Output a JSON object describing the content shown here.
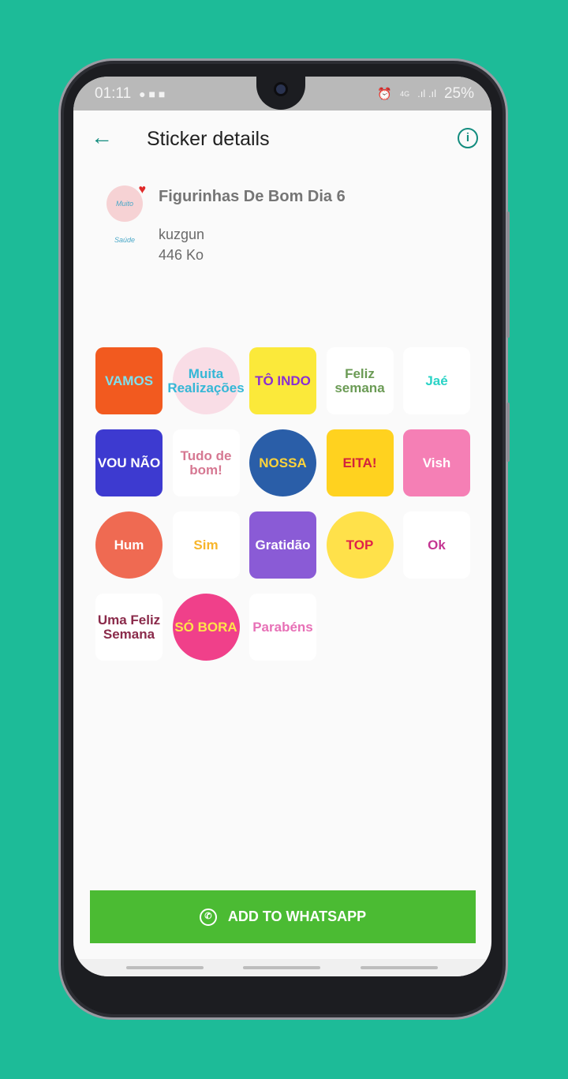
{
  "status_bar": {
    "time": "01:11",
    "battery": "25%",
    "network": "4G"
  },
  "toolbar": {
    "title": "Sticker details",
    "back_icon": "arrow-left-icon",
    "info_icon": "info-icon"
  },
  "pack": {
    "tray_text": "Muito Saúde",
    "name": "Figurinhas De Bom Dia 6",
    "publisher": "kuzgun",
    "size": "446 Ko"
  },
  "stickers": [
    {
      "text": "VAMOS",
      "bg": "#f25a1f",
      "fg": "#7fe0ee"
    },
    {
      "text": "Muita Realizações",
      "bg": "#f9dde6",
      "fg": "#35b7d6"
    },
    {
      "text": "TÔ INDO",
      "bg": "#fbe93a",
      "fg": "#8a2fd1"
    },
    {
      "text": "Feliz semana",
      "bg": "#ffffff",
      "fg": "#6b9b55"
    },
    {
      "text": "Jaé",
      "bg": "#ffffff",
      "fg": "#2ad3c6"
    },
    {
      "text": "VOU NÃO",
      "bg": "#3d3ad0",
      "fg": "#ffffff"
    },
    {
      "text": "Tudo de bom!",
      "bg": "#ffffff",
      "fg": "#d67892"
    },
    {
      "text": "NOSSA",
      "bg": "#2a5ea8",
      "fg": "#ffd43a"
    },
    {
      "text": "EITA!",
      "bg": "#ffd21f",
      "fg": "#d1233d"
    },
    {
      "text": "Vish",
      "bg": "#f57fb5",
      "fg": "#ffffff"
    },
    {
      "text": "Hum",
      "bg": "#ef6a52",
      "fg": "#ffffff"
    },
    {
      "text": "Sim",
      "bg": "#ffffff",
      "fg": "#f7b52a"
    },
    {
      "text": "Gratidão",
      "bg": "#8a5bd6",
      "fg": "#ffffff"
    },
    {
      "text": "TOP",
      "bg": "#ffe14a",
      "fg": "#e0214a"
    },
    {
      "text": "Ok",
      "bg": "#ffffff",
      "fg": "#c43592"
    },
    {
      "text": "Uma Feliz Semana",
      "bg": "#ffffff",
      "fg": "#8a2a4a"
    },
    {
      "text": "SÓ BORA",
      "bg": "#f0408a",
      "fg": "#ffe34a"
    },
    {
      "text": "Parabéns",
      "bg": "#ffffff",
      "fg": "#e770b6"
    }
  ],
  "add_button": {
    "label": "ADD TO WHATSAPP",
    "icon": "whatsapp-icon",
    "color": "#4bbb33"
  },
  "colors": {
    "background": "#1dbb98",
    "accent": "#128c7e"
  }
}
